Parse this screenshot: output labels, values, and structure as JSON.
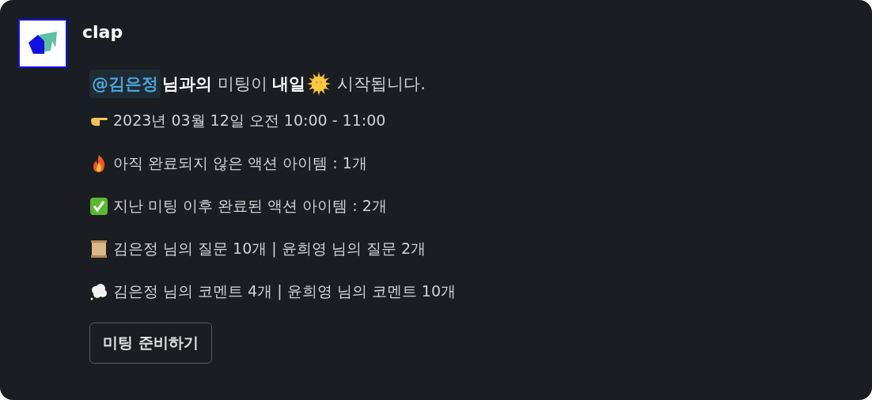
{
  "sender": {
    "name": "clap"
  },
  "headline": {
    "mention": "@김은정",
    "before_icon": "**님과의** 미팅이 **내일**",
    "after_icon": "시작됩니다."
  },
  "lines": [
    {
      "kind": "pointing-hand",
      "text": "2023년 03월 12일 오전 10:00 - 11:00"
    },
    {
      "kind": "fire",
      "text": "아직 완료되지 않은 액션 아이템 : 1개"
    },
    {
      "kind": "check",
      "text": "지난 미팅 이후 완료된 액션 아이템 : 2개"
    },
    {
      "kind": "scroll",
      "text": "김은정 님의 질문 10개 | 윤희영 님의 질문 2개"
    },
    {
      "kind": "thought",
      "text": "김은정 님의 코멘트 4개 | 윤희영 님의 코멘트 10개"
    }
  ],
  "button": {
    "label": "미팅 준비하기"
  }
}
